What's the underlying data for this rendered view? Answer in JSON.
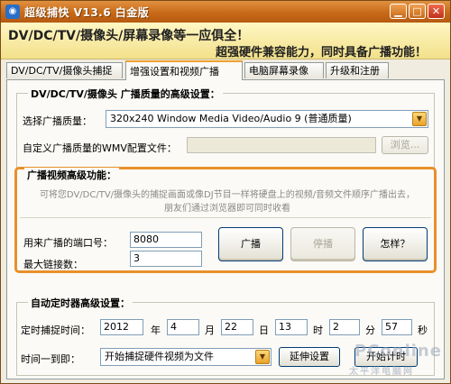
{
  "window": {
    "title": "超级捕快 V13.6 白金版"
  },
  "banner": {
    "slogan_primary": "DV/DC/TV/摄像头/屏幕录像等一应俱全！",
    "slogan_secondary": "超强硬件兼容能力，同时具备广播功能！"
  },
  "tabs": [
    {
      "label": "DV/DC/TV/摄像头捕捉",
      "active": false
    },
    {
      "label": "增强设置和视频广播",
      "active": true
    },
    {
      "label": "电脑屏幕录像",
      "active": false
    },
    {
      "label": "升级和注册",
      "active": false
    }
  ],
  "quality_group": {
    "legend": "DV/DC/TV/摄像头 广播质量的高级设置：",
    "select_label": "选择广播质量：",
    "select_value": "320x240 Window Media Video/Audio 9 (普通质量)",
    "wmv_label": "自定义广播质量的WMV配置文件：",
    "wmv_value": "",
    "browse_label": "浏览..."
  },
  "broadcast_group": {
    "legend": "广播视频高级功能：",
    "description": "可将您DV/DC/TV/摄像头的捕捉画面或像DJ节目一样将硬盘上的视频/音频文件顺序广播出去，朋友们通过浏览器即可同时收看",
    "port_label": "用来广播的端口号：",
    "port_value": "8080",
    "max_conn_label": "最大链接数：",
    "max_conn_value": "3",
    "broadcast_button": "广播",
    "stop_button": "停播",
    "how_button": "怎样？"
  },
  "timer_group": {
    "legend": "自动定时器高级设置：",
    "capture_time_label": "定时捕捉时间：",
    "year": "2012",
    "year_unit": "年",
    "month": "4",
    "month_unit": "月",
    "day": "22",
    "day_unit": "日",
    "hour": "13",
    "hour_unit": "时",
    "minute": "2",
    "minute_unit": "分",
    "second": "57",
    "second_unit": "秒",
    "action_label": "时间一到即：",
    "action_value": "开始捕捉硬件视频为文件",
    "delay_button": "延伸设置",
    "start_timer_button": "开始计时"
  },
  "watermark": {
    "big": "PConline",
    "small": "太平洋电脑网"
  },
  "colors": {
    "titlebar": "#c86a18",
    "accent_border": "#e8902a",
    "banner_bg": "#f7ecb0"
  }
}
